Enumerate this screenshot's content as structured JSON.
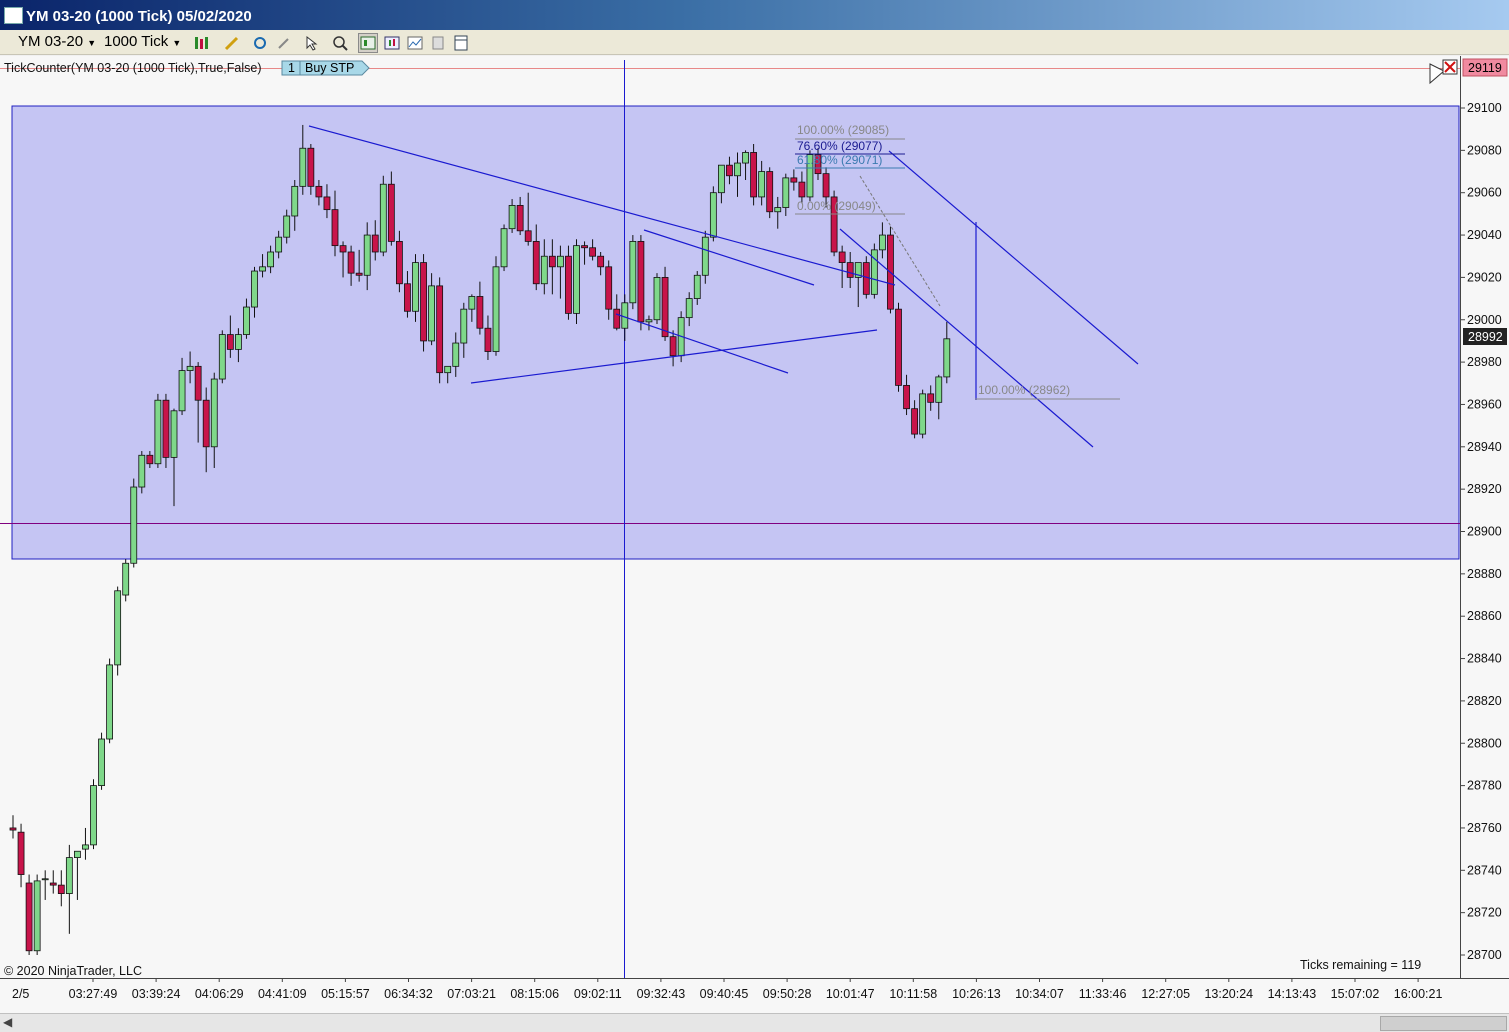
{
  "window": {
    "title": "YM 03-20 (1000 Tick)  05/02/2020"
  },
  "toolbar": {
    "instrument": "YM 03-20",
    "interval": "1000 Tick"
  },
  "indicator": {
    "label": "TickCounter(YM 03-20 (1000 Tick),True,False)",
    "order_qty": "1",
    "order_type": "Buy STP"
  },
  "price_axis": {
    "labels": [
      "29100",
      "29080",
      "29060",
      "29040",
      "29020",
      "29000",
      "28980",
      "28960",
      "28940",
      "28920",
      "28900",
      "28880",
      "28860",
      "28840",
      "28820",
      "28800",
      "28780",
      "28760",
      "28740",
      "28720",
      "28700"
    ],
    "order_price_tag": "29119",
    "last_price_tag": "28992"
  },
  "time_axis": {
    "date_label": "2/5",
    "labels": [
      "03:27:49",
      "03:39:24",
      "04:06:29",
      "04:41:09",
      "05:15:57",
      "06:34:32",
      "07:03:21",
      "08:15:06",
      "09:02:11",
      "09:32:43",
      "09:40:45",
      "09:50:28",
      "10:01:47",
      "10:11:58",
      "10:26:13",
      "10:34:07",
      "11:33:46",
      "12:27:05",
      "13:20:24",
      "14:13:43",
      "15:07:02",
      "16:00:21"
    ]
  },
  "fib_upper": [
    "100.00% (29085)",
    "76.60% (29077)",
    "61.80% (29071)",
    "0.00% (29049)"
  ],
  "fib_lower": "100.00% (28962)",
  "footer": {
    "copyright": "© 2020 NinjaTrader, LLC",
    "ticks_remaining": "Ticks remaining = 119"
  },
  "chart_data": {
    "type": "candlestick",
    "y_range": [
      28700,
      29100
    ],
    "candles": [
      {
        "o": 28760,
        "h": 28766,
        "l": 28755,
        "c": 28759
      },
      {
        "o": 28758,
        "h": 28762,
        "l": 28732,
        "c": 28738
      },
      {
        "o": 28734,
        "h": 28738,
        "l": 28700,
        "c": 28702
      },
      {
        "o": 28702,
        "h": 28738,
        "l": 28700,
        "c": 28735
      },
      {
        "o": 28736,
        "h": 28740,
        "l": 28726,
        "c": 28736
      },
      {
        "o": 28734,
        "h": 28740,
        "l": 28729,
        "c": 28733
      },
      {
        "o": 28733,
        "h": 28740,
        "l": 28723,
        "c": 28729
      },
      {
        "o": 28729,
        "h": 28752,
        "l": 28710,
        "c": 28746
      },
      {
        "o": 28746,
        "h": 28748,
        "l": 28726,
        "c": 28749
      },
      {
        "o": 28750,
        "h": 28760,
        "l": 28745,
        "c": 28752
      },
      {
        "o": 28752,
        "h": 28783,
        "l": 28750,
        "c": 28780
      },
      {
        "o": 28780,
        "h": 28805,
        "l": 28778,
        "c": 28802
      },
      {
        "o": 28802,
        "h": 28840,
        "l": 28800,
        "c": 28837
      },
      {
        "o": 28837,
        "h": 28874,
        "l": 28832,
        "c": 28872
      },
      {
        "o": 28870,
        "h": 28887,
        "l": 28867,
        "c": 28885
      },
      {
        "o": 28885,
        "h": 28925,
        "l": 28883,
        "c": 28921
      },
      {
        "o": 28921,
        "h": 28938,
        "l": 28918,
        "c": 28936
      },
      {
        "o": 28936,
        "h": 28938,
        "l": 28930,
        "c": 28932
      },
      {
        "o": 28932,
        "h": 28965,
        "l": 28930,
        "c": 28962
      },
      {
        "o": 28962,
        "h": 28965,
        "l": 28930,
        "c": 28935
      },
      {
        "o": 28935,
        "h": 28958,
        "l": 28912,
        "c": 28957
      },
      {
        "o": 28957,
        "h": 28982,
        "l": 28955,
        "c": 28976
      },
      {
        "o": 28976,
        "h": 28985,
        "l": 28970,
        "c": 28978
      },
      {
        "o": 28978,
        "h": 28980,
        "l": 28942,
        "c": 28962
      },
      {
        "o": 28962,
        "h": 28968,
        "l": 28928,
        "c": 28940
      },
      {
        "o": 28940,
        "h": 28975,
        "l": 28930,
        "c": 28972
      },
      {
        "o": 28972,
        "h": 28995,
        "l": 28970,
        "c": 28993
      },
      {
        "o": 28993,
        "h": 29002,
        "l": 28982,
        "c": 28986
      },
      {
        "o": 28986,
        "h": 28996,
        "l": 28980,
        "c": 28993
      },
      {
        "o": 28993,
        "h": 29010,
        "l": 28991,
        "c": 29006
      },
      {
        "o": 29006,
        "h": 29025,
        "l": 29001,
        "c": 29023
      },
      {
        "o": 29023,
        "h": 29031,
        "l": 29020,
        "c": 29025
      },
      {
        "o": 29025,
        "h": 29035,
        "l": 29022,
        "c": 29032
      },
      {
        "o": 29032,
        "h": 29042,
        "l": 29029,
        "c": 29039
      },
      {
        "o": 29039,
        "h": 29052,
        "l": 29036,
        "c": 29049
      },
      {
        "o": 29049,
        "h": 29066,
        "l": 29042,
        "c": 29063
      },
      {
        "o": 29063,
        "h": 29092,
        "l": 29059,
        "c": 29081
      },
      {
        "o": 29081,
        "h": 29083,
        "l": 29059,
        "c": 29063
      },
      {
        "o": 29063,
        "h": 29066,
        "l": 29054,
        "c": 29058
      },
      {
        "o": 29058,
        "h": 29064,
        "l": 29048,
        "c": 29052
      },
      {
        "o": 29052,
        "h": 29061,
        "l": 29030,
        "c": 29035
      },
      {
        "o": 29035,
        "h": 29037,
        "l": 29020,
        "c": 29032
      },
      {
        "o": 29032,
        "h": 29035,
        "l": 29016,
        "c": 29022
      },
      {
        "o": 29022,
        "h": 29033,
        "l": 29018,
        "c": 29021
      },
      {
        "o": 29021,
        "h": 29046,
        "l": 29014,
        "c": 29040
      },
      {
        "o": 29040,
        "h": 29047,
        "l": 29028,
        "c": 29032
      },
      {
        "o": 29032,
        "h": 29068,
        "l": 29030,
        "c": 29064
      },
      {
        "o": 29064,
        "h": 29070,
        "l": 29035,
        "c": 29037
      },
      {
        "o": 29037,
        "h": 29042,
        "l": 29013,
        "c": 29017
      },
      {
        "o": 29017,
        "h": 29023,
        "l": 29001,
        "c": 29004
      },
      {
        "o": 29004,
        "h": 29031,
        "l": 28999,
        "c": 29027
      },
      {
        "o": 29027,
        "h": 29031,
        "l": 28985,
        "c": 28990
      },
      {
        "o": 28990,
        "h": 29022,
        "l": 28988,
        "c": 29016
      },
      {
        "o": 29016,
        "h": 29020,
        "l": 28970,
        "c": 28975
      },
      {
        "o": 28975,
        "h": 28978,
        "l": 28970,
        "c": 28978
      },
      {
        "o": 28978,
        "h": 28994,
        "l": 28973,
        "c": 28989
      },
      {
        "o": 28989,
        "h": 29008,
        "l": 28982,
        "c": 29005
      },
      {
        "o": 29005,
        "h": 29012,
        "l": 28999,
        "c": 29011
      },
      {
        "o": 29011,
        "h": 29018,
        "l": 28993,
        "c": 28996
      },
      {
        "o": 28996,
        "h": 29002,
        "l": 28981,
        "c": 28985
      },
      {
        "o": 28985,
        "h": 29030,
        "l": 28983,
        "c": 29025
      },
      {
        "o": 29025,
        "h": 29045,
        "l": 29023,
        "c": 29043
      },
      {
        "o": 29043,
        "h": 29057,
        "l": 29041,
        "c": 29054
      },
      {
        "o": 29054,
        "h": 29058,
        "l": 29040,
        "c": 29042
      },
      {
        "o": 29042,
        "h": 29060,
        "l": 29035,
        "c": 29037
      },
      {
        "o": 29037,
        "h": 29045,
        "l": 29014,
        "c": 29017
      },
      {
        "o": 29017,
        "h": 29038,
        "l": 29012,
        "c": 29030
      },
      {
        "o": 29030,
        "h": 29038,
        "l": 29012,
        "c": 29025
      },
      {
        "o": 29025,
        "h": 29035,
        "l": 29010,
        "c": 29030
      },
      {
        "o": 29030,
        "h": 29035,
        "l": 29000,
        "c": 29003
      },
      {
        "o": 29003,
        "h": 29038,
        "l": 28998,
        "c": 29035
      },
      {
        "o": 29035,
        "h": 29037,
        "l": 29026,
        "c": 29034
      },
      {
        "o": 29034,
        "h": 29038,
        "l": 29028,
        "c": 29030
      },
      {
        "o": 29030,
        "h": 29032,
        "l": 29021,
        "c": 29025
      },
      {
        "o": 29025,
        "h": 29028,
        "l": 29000,
        "c": 29005
      },
      {
        "o": 29005,
        "h": 29012,
        "l": 28995,
        "c": 28996
      },
      {
        "o": 28996,
        "h": 29012,
        "l": 28990,
        "c": 29008
      },
      {
        "o": 29008,
        "h": 29040,
        "l": 29005,
        "c": 29037
      },
      {
        "o": 29037,
        "h": 29040,
        "l": 28995,
        "c": 28999
      },
      {
        "o": 28999,
        "h": 29002,
        "l": 28995,
        "c": 29000
      },
      {
        "o": 29000,
        "h": 29022,
        "l": 28998,
        "c": 29020
      },
      {
        "o": 29020,
        "h": 29025,
        "l": 28990,
        "c": 28992
      },
      {
        "o": 28992,
        "h": 28995,
        "l": 28978,
        "c": 28983
      },
      {
        "o": 28983,
        "h": 29004,
        "l": 28980,
        "c": 29001
      },
      {
        "o": 29001,
        "h": 29013,
        "l": 28997,
        "c": 29010
      },
      {
        "o": 29010,
        "h": 29023,
        "l": 29007,
        "c": 29021
      },
      {
        "o": 29021,
        "h": 29042,
        "l": 29017,
        "c": 29039
      },
      {
        "o": 29039,
        "h": 29063,
        "l": 29037,
        "c": 29060
      },
      {
        "o": 29060,
        "h": 29069,
        "l": 29055,
        "c": 29073
      },
      {
        "o": 29073,
        "h": 29077,
        "l": 29064,
        "c": 29068
      },
      {
        "o": 29068,
        "h": 29079,
        "l": 29058,
        "c": 29074
      },
      {
        "o": 29074,
        "h": 29080,
        "l": 29066,
        "c": 29079
      },
      {
        "o": 29079,
        "h": 29083,
        "l": 29054,
        "c": 29058
      },
      {
        "o": 29058,
        "h": 29075,
        "l": 29054,
        "c": 29070
      },
      {
        "o": 29070,
        "h": 29072,
        "l": 29048,
        "c": 29051
      },
      {
        "o": 29051,
        "h": 29058,
        "l": 29043,
        "c": 29053
      },
      {
        "o": 29053,
        "h": 29069,
        "l": 29049,
        "c": 29067
      },
      {
        "o": 29067,
        "h": 29071,
        "l": 29061,
        "c": 29065
      },
      {
        "o": 29065,
        "h": 29070,
        "l": 29055,
        "c": 29058
      },
      {
        "o": 29058,
        "h": 29080,
        "l": 29056,
        "c": 29078
      },
      {
        "o": 29078,
        "h": 29081,
        "l": 29066,
        "c": 29069
      },
      {
        "o": 29069,
        "h": 29072,
        "l": 29053,
        "c": 29058
      },
      {
        "o": 29058,
        "h": 29061,
        "l": 29030,
        "c": 29032
      },
      {
        "o": 29032,
        "h": 29035,
        "l": 29015,
        "c": 29027
      },
      {
        "o": 29027,
        "h": 29032,
        "l": 29015,
        "c": 29020
      },
      {
        "o": 29020,
        "h": 29024,
        "l": 29006,
        "c": 29027
      },
      {
        "o": 29027,
        "h": 29030,
        "l": 29010,
        "c": 29012
      },
      {
        "o": 29012,
        "h": 29036,
        "l": 29010,
        "c": 29033
      },
      {
        "o": 29033,
        "h": 29046,
        "l": 29029,
        "c": 29040
      },
      {
        "o": 29040,
        "h": 29044,
        "l": 29003,
        "c": 29005
      },
      {
        "o": 29005,
        "h": 29008,
        "l": 28966,
        "c": 28969
      },
      {
        "o": 28969,
        "h": 28974,
        "l": 28955,
        "c": 28958
      },
      {
        "o": 28958,
        "h": 28962,
        "l": 28944,
        "c": 28946
      },
      {
        "o": 28946,
        "h": 28967,
        "l": 28944,
        "c": 28965
      },
      {
        "o": 28965,
        "h": 28969,
        "l": 28957,
        "c": 28961
      },
      {
        "o": 28961,
        "h": 28974,
        "l": 28953,
        "c": 28973
      },
      {
        "o": 28973,
        "h": 28999,
        "l": 28970,
        "c": 28991
      }
    ]
  }
}
